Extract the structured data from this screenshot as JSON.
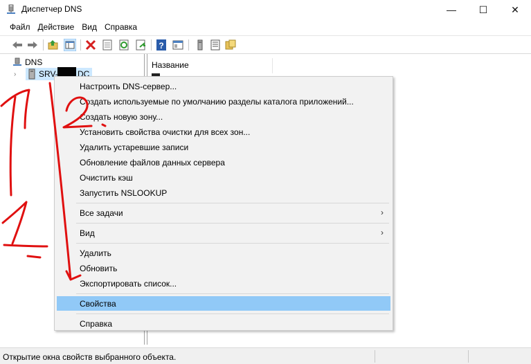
{
  "window": {
    "title": "Диспетчер DNS",
    "buttons": {
      "minimize": "—",
      "maximize": "☐",
      "close": "✕"
    }
  },
  "menubar": [
    "Файл",
    "Действие",
    "Вид",
    "Справка"
  ],
  "tree": {
    "root": "DNS",
    "server_prefix": "SRV-",
    "server_suffix": "DC",
    "expander": "›"
  },
  "content": {
    "column_header": "Название"
  },
  "context_menu": {
    "groups": [
      [
        "Настроить DNS-сервер...",
        "Создать используемые по умолчанию разделы каталога приложений...",
        "Создать новую зону...",
        "Установить свойства очистки для всех зон...",
        "Удалить устаревшие записи",
        "Обновление файлов данных сервера",
        "Очистить кэш",
        "Запустить NSLOOKUP"
      ],
      [
        "Все задачи"
      ],
      [
        "Вид"
      ],
      [
        "Удалить",
        "Обновить",
        "Экспортировать список..."
      ],
      [
        "Свойства"
      ],
      [
        "Справка"
      ]
    ],
    "submenu_arrow": "›",
    "selected": "Свойства"
  },
  "status": {
    "text": "Открытие окна свойств выбранного объекта."
  },
  "annotations": {
    "color": "#e01010",
    "labels": [
      "1.",
      "2."
    ]
  },
  "icons": [
    "dns-app-icon",
    "back-icon",
    "forward-icon",
    "up-folder-icon",
    "show-hide-tree-icon",
    "delete-icon",
    "properties-icon",
    "refresh-icon",
    "export-icon",
    "help-icon",
    "snapin-icon",
    "server-icon",
    "list-icon",
    "folder-icon"
  ]
}
